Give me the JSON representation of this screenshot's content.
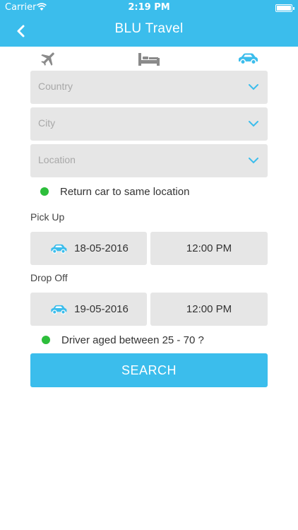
{
  "status": {
    "carrier": "Carrier",
    "time": "2:19 PM"
  },
  "nav": {
    "title": "BLU Travel"
  },
  "tabs": [
    {
      "id": "flight",
      "icon": "airplane-icon",
      "active": false
    },
    {
      "id": "hotel",
      "icon": "bed-icon",
      "active": false
    },
    {
      "id": "car",
      "icon": "car-icon",
      "active": true
    }
  ],
  "form": {
    "country_placeholder": "Country",
    "city_placeholder": "City",
    "location_placeholder": "Location",
    "return_same_label": "Return car to same location",
    "pickup_label": "Pick Up",
    "pickup_date": "18-05-2016",
    "pickup_time": "12:00 PM",
    "dropoff_label": "Drop Off",
    "dropoff_date": "19-05-2016",
    "dropoff_time": "12:00 PM",
    "driver_age_label": "Driver aged between 25 - 70 ?",
    "search_label": "SEARCH"
  },
  "colors": {
    "accent": "#3bbdec",
    "field_bg": "#e6e6e6",
    "check_green": "#2dbe3b",
    "icon_gray": "#8a8a8a"
  }
}
